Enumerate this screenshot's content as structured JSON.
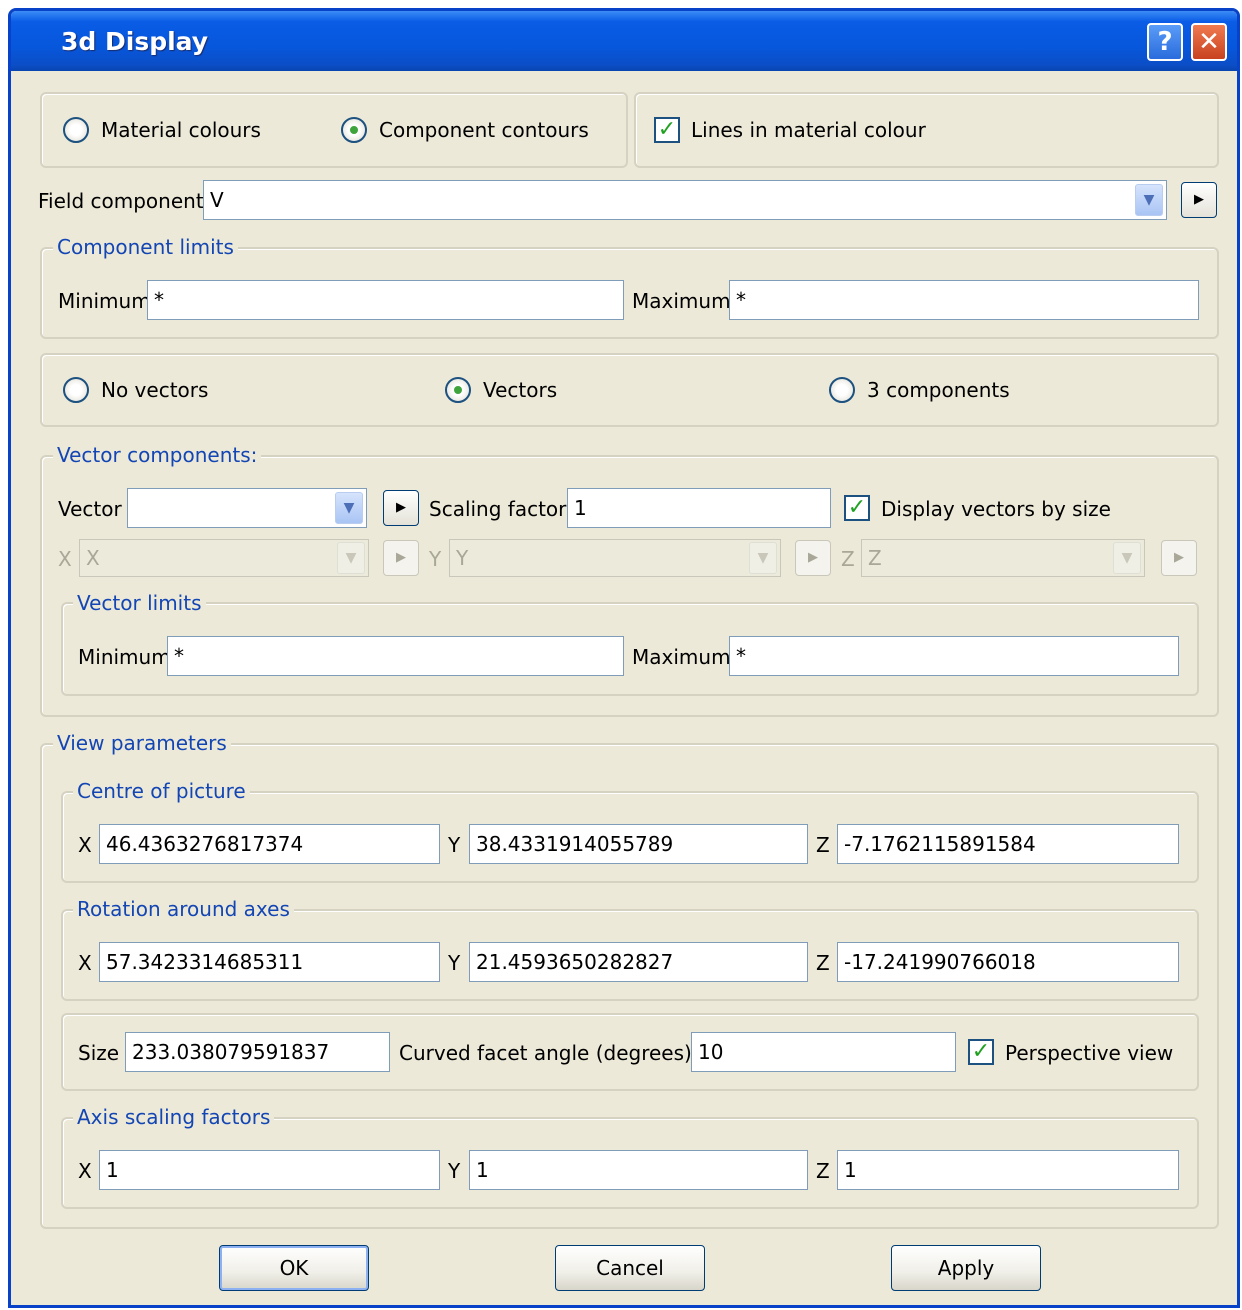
{
  "window": {
    "title": "3d Display",
    "help_icon": "?",
    "close_icon": "✕"
  },
  "colour_mode": {
    "material_colours": "Material colours",
    "component_contours": "Component contours",
    "lines_in_material_colour": "Lines in material colour",
    "selected": "component_contours",
    "lines_checked": true
  },
  "field_component": {
    "label": "Field component",
    "value": "V"
  },
  "component_limits": {
    "title": "Component limits",
    "min_label": "Minimum",
    "min_value": "*",
    "max_label": "Maximum",
    "max_value": "*"
  },
  "vector_mode": {
    "no_vectors": "No vectors",
    "vectors": "Vectors",
    "three_components": "3 components",
    "selected": "vectors"
  },
  "vector_components": {
    "title": "Vector components:",
    "vector_label": "Vector",
    "vector_value": "",
    "scaling_label": "Scaling factor",
    "scaling_value": "1",
    "display_by_size": "Display vectors by size",
    "display_by_size_checked": true,
    "x_label": "X",
    "x_value": "X",
    "y_label": "Y",
    "y_value": "Y",
    "z_label": "Z",
    "z_value": "Z"
  },
  "vector_limits": {
    "title": "Vector limits",
    "min_label": "Minimum",
    "min_value": "*",
    "max_label": "Maximum",
    "max_value": "*"
  },
  "view": {
    "title": "View parameters",
    "centre": {
      "title": "Centre of picture",
      "x_label": "X",
      "x": "46.4363276817374",
      "y_label": "Y",
      "y": "38.4331914055789",
      "z_label": "Z",
      "z": "-7.1762115891584"
    },
    "rotation": {
      "title": "Rotation around axes",
      "x_label": "X",
      "x": "57.3423314685311",
      "y_label": "Y",
      "y": "21.4593650282827",
      "z_label": "Z",
      "z": "-17.241990766018"
    },
    "size_label": "Size",
    "size": "233.038079591837",
    "facet_label": "Curved facet angle (degrees)",
    "facet": "10",
    "perspective_label": "Perspective view",
    "perspective_checked": true,
    "axis": {
      "title": "Axis scaling factors",
      "x_label": "X",
      "x": "1",
      "y_label": "Y",
      "y": "1",
      "z_label": "Z",
      "z": "1"
    }
  },
  "buttons": {
    "ok": "OK",
    "cancel": "Cancel",
    "apply": "Apply"
  },
  "colors": {
    "title_bar": "#0757dc",
    "dialog_bg": "#ece9d8",
    "group_title": "#1346b4",
    "radio_dot": "#3fa43c",
    "check_mark": "#21a121"
  },
  "icons": {
    "dropdown": "chevron-down-icon",
    "arrow": "play-arrow-icon",
    "check": "checkmark-icon"
  }
}
